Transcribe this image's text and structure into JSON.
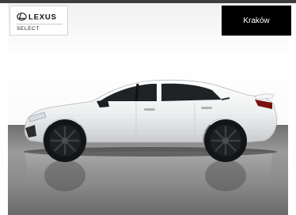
{
  "brand": {
    "logo_text": "LEXUS",
    "program": "SELECT"
  },
  "location": {
    "city": "Kraków"
  },
  "colors": {
    "badge_background": "#000000",
    "badge_text": "#ffffff",
    "car_body": "#f4f5f6",
    "floor": "#8a8a8a"
  },
  "image": {
    "subject": "car-side-view-icon"
  }
}
